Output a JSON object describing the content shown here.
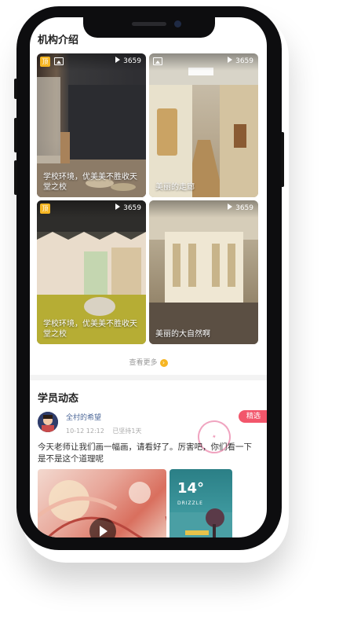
{
  "intro": {
    "title": "机构介绍",
    "tiles": [
      {
        "caption": "学校环境，优美美不胜收天堂之校",
        "views": "3659",
        "vip": true,
        "vip_text": "顶"
      },
      {
        "caption": "美丽的走廊",
        "views": "3659",
        "vip": false
      },
      {
        "caption": "学校环境，优美美不胜收天堂之校",
        "views": "3659",
        "vip": true,
        "vip_text": "顶"
      },
      {
        "caption": "美丽的大自然啊",
        "views": "3659",
        "vip": false
      }
    ],
    "more_label": "查看更多"
  },
  "feed": {
    "title": "学员动态",
    "post": {
      "user": "全村的希望",
      "date": "10-12 12:12",
      "streak": "已坚持1天",
      "badge": "精选",
      "text": "今天老师让我们画一幅画，请看好了。厉害吧，你们看一下是不是这个道理呢",
      "weather_temp": "14°",
      "weather_label": "DRIZZLE"
    }
  },
  "colors": {
    "accent": "#f6b623",
    "badge": "#f2566b",
    "link": "#4f6a9a"
  }
}
